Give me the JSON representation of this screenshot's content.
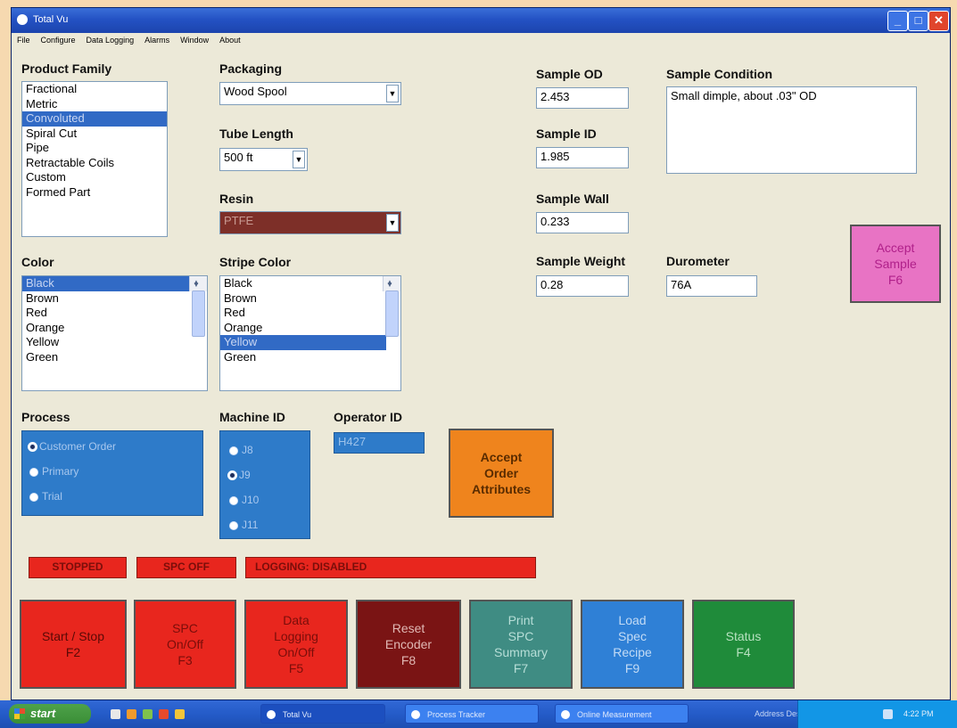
{
  "window": {
    "title": "Total Vu",
    "buttons": [
      "_",
      "□",
      "✕"
    ]
  },
  "menu": [
    "File",
    "Configure",
    "Data Logging",
    "Alarms",
    "Window",
    "About"
  ],
  "product_family": {
    "label": "Product Family",
    "items": [
      "Fractional",
      "Metric",
      "Convoluted",
      "Spiral Cut",
      "Pipe",
      "Retractable Coils",
      "Custom",
      "Formed Part"
    ],
    "selected": "Convoluted"
  },
  "packaging": {
    "label": "Packaging",
    "value": "Wood Spool"
  },
  "tube_length": {
    "label": "Tube Length",
    "value": "500 ft"
  },
  "resin": {
    "label": "Resin",
    "value": "PTFE"
  },
  "color": {
    "label": "Color",
    "items": [
      "Black",
      "Brown",
      "Red",
      "Orange",
      "Yellow",
      "Green"
    ],
    "selected": "Black"
  },
  "stripe_color": {
    "label": "Stripe Color",
    "items": [
      "Black",
      "Brown",
      "Red",
      "Orange",
      "Yellow",
      "Green"
    ],
    "selected": "Yellow"
  },
  "sample": {
    "od_label": "Sample OD",
    "od_value": "2.453",
    "id_label": "Sample ID",
    "id_value": "1.985",
    "wall_label": "Sample Wall",
    "wall_value": "0.233",
    "weight_label": "Sample Weight",
    "weight_value": "0.28",
    "durometer_label": "Durometer",
    "durometer_value": "76A",
    "condition_label": "Sample Condition",
    "condition_value": "Small dimple, about .03\" OD"
  },
  "accept_sample": {
    "line1": "Accept",
    "line2": "Sample",
    "line3": "F6"
  },
  "process": {
    "label": "Process",
    "options": [
      "Customer Order",
      "Primary",
      "Trial"
    ],
    "selected": "Customer Order"
  },
  "machine_id": {
    "label": "Machine ID",
    "options": [
      "J8",
      "J9",
      "J10",
      "J11"
    ],
    "selected": "J9"
  },
  "operator_id": {
    "label": "Operator ID",
    "value": "H427"
  },
  "accept_order": {
    "line1": "Accept",
    "line2": "Order",
    "line3": "Attributes"
  },
  "status": {
    "run": "STOPPED",
    "spc": "SPC OFF",
    "logging": "LOGGING: DISABLED"
  },
  "fkeys": [
    {
      "line1": "Start / Stop",
      "line2": "F2",
      "line3": "",
      "line4": ""
    },
    {
      "line1": "SPC",
      "line2": "On/Off",
      "line3": "F3",
      "line4": ""
    },
    {
      "line1": "Data",
      "line2": "Logging",
      "line3": "On/Off",
      "line4": "F5"
    },
    {
      "line1": "Reset",
      "line2": "Encoder",
      "line3": "F8",
      "line4": ""
    },
    {
      "line1": "Print",
      "line2": "SPC",
      "line3": "Summary",
      "line4": "F7"
    },
    {
      "line1": "Load",
      "line2": "Spec",
      "line3": "Recipe",
      "line4": "F9"
    },
    {
      "line1": "Status",
      "line2": "F4",
      "line3": "",
      "line4": ""
    }
  ],
  "colors": {
    "start_stop": "#e8261e",
    "spc": "#e8261e",
    "logging": "#e8261e",
    "reset": "#7a1414",
    "print": "#3f8c83",
    "load": "#2f80d6",
    "status": "#1f8b3a",
    "accept_sample": "#e873c4",
    "accept_order": "#ef841d"
  },
  "taskbar": {
    "start": "start",
    "tasks": [
      "Total Vu",
      "Process Tracker",
      "Online Measurement"
    ],
    "tray_text": "Address  Desktop",
    "clock": "4:22 PM"
  }
}
